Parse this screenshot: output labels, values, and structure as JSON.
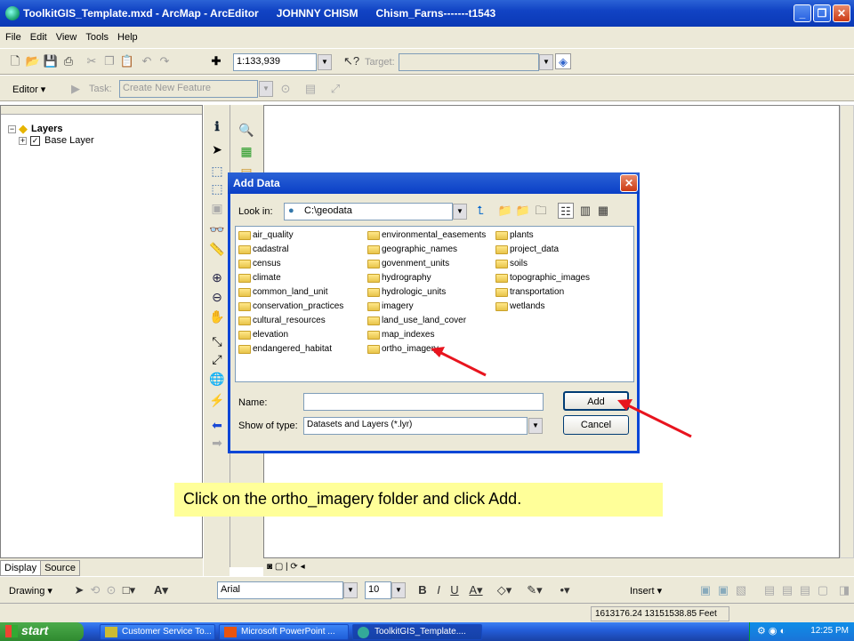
{
  "window": {
    "title": "ToolkitGIS_Template.mxd - ArcMap - ArcEditor      JOHNNY CHISM      Chism_Farns-------t1543"
  },
  "menu": [
    "File",
    "Edit",
    "View",
    "Tools",
    "Help"
  ],
  "standard_toolbar": {
    "scale": "1:133,939",
    "target_label": "Target:"
  },
  "editor_toolbar": {
    "editor_label": "Editor",
    "task_label": "Task:",
    "task_value": "Create New Feature"
  },
  "toc": {
    "root": "Layers",
    "layers": [
      {
        "name": "Base Layer",
        "checked": true
      }
    ],
    "tabs": [
      "Display",
      "Source"
    ]
  },
  "dialog": {
    "title": "Add Data",
    "look_in_label": "Look in:",
    "look_in_value": "C:\\geodata",
    "folders": [
      [
        "air_quality",
        "cadastral",
        "census",
        "climate",
        "common_land_unit",
        "conservation_practices",
        "cultural_resources",
        "elevation",
        "endangered_habitat"
      ],
      [
        "environmental_easements",
        "geographic_names",
        "govenment_units",
        "hydrography",
        "hydrologic_units",
        "imagery",
        "land_use_land_cover",
        "map_indexes",
        "ortho_imagery"
      ],
      [
        "plants",
        "project_data",
        "soils",
        "topographic_images",
        "transportation",
        "wetlands"
      ]
    ],
    "name_label": "Name:",
    "name_value": "",
    "type_label": "Show of type:",
    "type_value": "Datasets and Layers (*.lyr)",
    "add_button": "Add",
    "cancel_button": "Cancel"
  },
  "instruction": "Click on the ortho_imagery folder and click Add.",
  "drawing_toolbar": {
    "drawing_label": "Drawing",
    "font": "Arial",
    "size": "10",
    "insert_label": "Insert"
  },
  "status": {
    "coords": "1613176.24  13151538.85 Feet"
  },
  "taskbar": {
    "start": "start",
    "tasks": [
      "Customer Service To...",
      "Microsoft PowerPoint ...",
      "ToolkitGIS_Template...."
    ],
    "time": "12:25 PM"
  },
  "colors": {
    "titlebar": "#1143c4",
    "chrome": "#ece9d8",
    "callout": "#ffff99",
    "arrow": "#e8141e"
  }
}
